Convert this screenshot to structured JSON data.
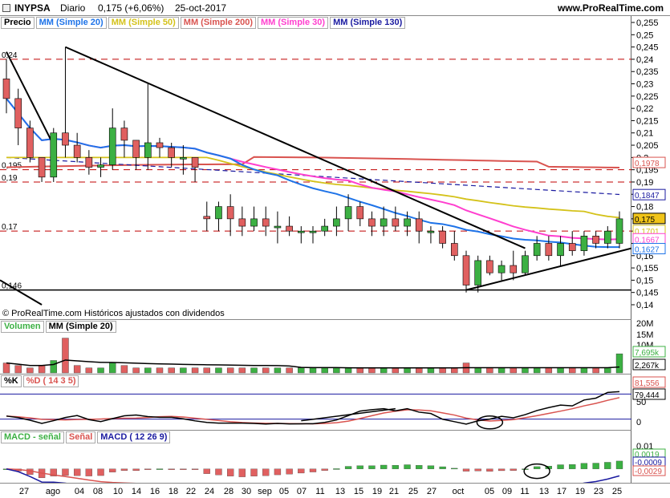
{
  "header": {
    "ticker": "INYPSA",
    "period": "Diario",
    "change": "0,175 (+6,06%)",
    "date": "25-oct-2017",
    "site": "www.ProRealTime.com"
  },
  "price_legend": [
    "Precio",
    "MM (Simple 20)",
    "MM (Simple 50)",
    "MM (Simple 200)",
    "MM (Simple 30)",
    "MM (Simple 130)"
  ],
  "legend_colors": [
    "#000000",
    "#1e73e8",
    "#d4c21a",
    "#d9534f",
    "#ff3fcf",
    "#1a1aa0"
  ],
  "copyright": "© ProRealTime.com  Históricos ajustados con dividendos",
  "price_ticks": [
    "0,255",
    "0,25",
    "0,245",
    "0,24",
    "0,235",
    "0,23",
    "0,225",
    "0,22",
    "0,215",
    "0,21",
    "0,205",
    "0,2",
    "0,195",
    "0,19",
    "0,185",
    "0,18",
    "0,175",
    "0,17",
    "0,165",
    "0,16",
    "0,155",
    "0,15",
    "0,145",
    "0,14"
  ],
  "level_labels": [
    "0,24",
    "0,195",
    "0,19",
    "0,17",
    "0,146"
  ],
  "price_tags": [
    {
      "text": "0,1978",
      "color": "#d9534f"
    },
    {
      "text": "0,1847",
      "color": "#1a1aa0"
    },
    {
      "text": "0,175",
      "color": "#000000",
      "bg": "#f0c419"
    },
    {
      "text": "0,1701",
      "color": "#d4c21a"
    },
    {
      "text": "0,1667",
      "color": "#ff3fcf"
    },
    {
      "text": "0,1627",
      "color": "#1e73e8"
    }
  ],
  "volume_legend": [
    "Volumen",
    "MM (Simple 20)"
  ],
  "volume_ticks": [
    "20M",
    "15M",
    "10M"
  ],
  "volume_tags": [
    "7,695k",
    "2,267k"
  ],
  "stoch_legend": [
    "%K",
    "%D ( 14 3 5)"
  ],
  "stoch_ticks": [
    "50",
    "0"
  ],
  "stoch_tags": [
    "81,556",
    "79,444"
  ],
  "macd_legend": [
    "MACD - señal",
    "Señal",
    "MACD ( 12 26 9)"
  ],
  "macd_ticks": [
    "0,01"
  ],
  "macd_tags": [
    "0,0019",
    "-0,0009",
    "-0,0029"
  ],
  "x_labels": [
    "27",
    "ago",
    "04",
    "08",
    "10",
    "14",
    "16",
    "18",
    "22",
    "24",
    "28",
    "30",
    "sep",
    "05",
    "07",
    "11",
    "13",
    "15",
    "19",
    "21",
    "25",
    "27",
    "oct",
    "05",
    "09",
    "11",
    "13",
    "17",
    "19",
    "23",
    "25"
  ],
  "chart_data": {
    "type": "candlestick",
    "title": "INYPSA Diario",
    "ylim": [
      0.14,
      0.255
    ],
    "ohlc": [
      [
        0.232,
        0.24,
        0.218,
        0.224
      ],
      [
        0.224,
        0.228,
        0.205,
        0.212
      ],
      [
        0.212,
        0.215,
        0.198,
        0.2
      ],
      [
        0.2,
        0.2,
        0.19,
        0.192
      ],
      [
        0.192,
        0.212,
        0.19,
        0.21
      ],
      [
        0.21,
        0.245,
        0.2,
        0.205
      ],
      [
        0.205,
        0.21,
        0.198,
        0.2
      ],
      [
        0.2,
        0.203,
        0.193,
        0.196
      ],
      [
        0.196,
        0.2,
        0.192,
        0.197
      ],
      [
        0.197,
        0.22,
        0.195,
        0.212
      ],
      [
        0.212,
        0.215,
        0.2,
        0.207
      ],
      [
        0.207,
        0.207,
        0.195,
        0.2
      ],
      [
        0.2,
        0.23,
        0.195,
        0.206
      ],
      [
        0.206,
        0.208,
        0.2,
        0.204
      ],
      [
        0.204,
        0.206,
        0.196,
        0.2
      ],
      [
        0.2,
        0.205,
        0.193,
        0.2
      ],
      [
        0.2,
        0.2,
        0.19,
        0.196
      ],
      [
        0.176,
        0.182,
        0.17,
        0.175
      ],
      [
        0.175,
        0.182,
        0.17,
        0.18
      ],
      [
        0.18,
        0.185,
        0.168,
        0.175
      ],
      [
        0.175,
        0.18,
        0.168,
        0.172
      ],
      [
        0.172,
        0.18,
        0.17,
        0.175
      ],
      [
        0.175,
        0.18,
        0.168,
        0.172
      ],
      [
        0.172,
        0.178,
        0.165,
        0.172
      ],
      [
        0.172,
        0.176,
        0.168,
        0.17
      ],
      [
        0.17,
        0.172,
        0.165,
        0.17
      ],
      [
        0.17,
        0.172,
        0.165,
        0.17
      ],
      [
        0.17,
        0.175,
        0.168,
        0.172
      ],
      [
        0.172,
        0.18,
        0.168,
        0.175
      ],
      [
        0.175,
        0.185,
        0.17,
        0.18
      ],
      [
        0.18,
        0.182,
        0.172,
        0.175
      ],
      [
        0.175,
        0.178,
        0.168,
        0.172
      ],
      [
        0.172,
        0.18,
        0.168,
        0.175
      ],
      [
        0.175,
        0.18,
        0.17,
        0.172
      ],
      [
        0.172,
        0.178,
        0.168,
        0.175
      ],
      [
        0.175,
        0.178,
        0.165,
        0.17
      ],
      [
        0.17,
        0.172,
        0.165,
        0.17
      ],
      [
        0.17,
        0.172,
        0.163,
        0.165
      ],
      [
        0.165,
        0.17,
        0.158,
        0.16
      ],
      [
        0.16,
        0.162,
        0.145,
        0.148
      ],
      [
        0.148,
        0.16,
        0.145,
        0.158
      ],
      [
        0.158,
        0.16,
        0.152,
        0.153
      ],
      [
        0.153,
        0.158,
        0.15,
        0.156
      ],
      [
        0.156,
        0.162,
        0.15,
        0.153
      ],
      [
        0.153,
        0.162,
        0.152,
        0.16
      ],
      [
        0.16,
        0.168,
        0.158,
        0.165
      ],
      [
        0.165,
        0.168,
        0.158,
        0.16
      ],
      [
        0.16,
        0.168,
        0.156,
        0.165
      ],
      [
        0.165,
        0.17,
        0.16,
        0.162
      ],
      [
        0.162,
        0.17,
        0.16,
        0.168
      ],
      [
        0.168,
        0.17,
        0.163,
        0.165
      ],
      [
        0.165,
        0.172,
        0.163,
        0.17
      ],
      [
        0.165,
        0.178,
        0.163,
        0.175
      ]
    ],
    "volume": [
      4,
      3,
      2,
      3,
      5,
      14,
      3,
      2,
      2,
      4,
      3,
      2,
      2,
      2,
      2,
      2,
      2,
      2,
      2,
      2,
      2,
      2,
      2,
      2,
      2,
      2,
      2,
      2,
      2,
      2,
      2,
      2,
      2,
      2,
      2,
      2,
      2,
      2,
      2,
      4,
      2,
      2,
      2,
      2,
      2,
      2,
      2,
      2,
      2,
      2,
      2,
      2,
      7.695
    ],
    "stoch_range": [
      0,
      100
    ],
    "macd_range": [
      -0.004,
      0.01
    ]
  }
}
